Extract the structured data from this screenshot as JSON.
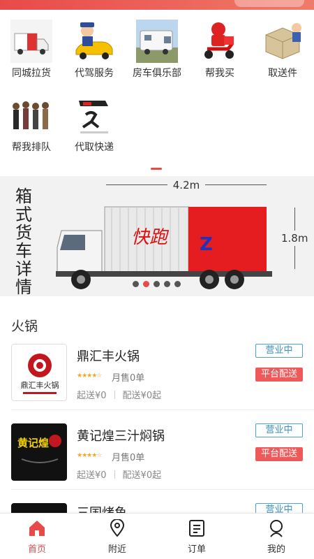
{
  "services": [
    {
      "label": "同城拉货",
      "icon": "truck-icon"
    },
    {
      "label": "代驾服务",
      "icon": "chauffeur-icon"
    },
    {
      "label": "房车俱乐部",
      "icon": "rv-icon"
    },
    {
      "label": "帮我买",
      "icon": "delivery-scooter-icon"
    },
    {
      "label": "取送件",
      "icon": "courier-box-icon"
    },
    {
      "label": "帮我排队",
      "icon": "queue-people-icon"
    },
    {
      "label": "代取快递",
      "icon": "express-run-icon"
    }
  ],
  "banner": {
    "title": "箱式货车详情",
    "width_label": "4.2m",
    "height_label": "1.8m",
    "truck_text": "快跑",
    "truck_letter": "Z",
    "slide_count": 5,
    "active_slide": 1
  },
  "section": {
    "title": "火锅"
  },
  "shops": [
    {
      "name": "鼎汇丰火锅",
      "rating": 4,
      "sales": "月售0单",
      "min_order": "起送¥0",
      "delivery_fee": "配送¥0起",
      "status": "营业中",
      "delivery_badge": "平台配送",
      "logo_text": "鼎汇丰火锅"
    },
    {
      "name": "黄记煌三汁焖锅",
      "rating": 4,
      "sales": "月售0单",
      "min_order": "起送¥0",
      "delivery_fee": "配送¥0起",
      "status": "营业中",
      "delivery_badge": "平台配送",
      "logo_text": "黄记煌"
    },
    {
      "name": "三国烤鱼",
      "status": "营业中"
    }
  ],
  "tabs": [
    {
      "label": "首页",
      "icon": "home-icon",
      "active": true
    },
    {
      "label": "附近",
      "icon": "location-pin-icon",
      "active": false
    },
    {
      "label": "订单",
      "icon": "order-list-icon",
      "active": false
    },
    {
      "label": "我的",
      "icon": "profile-icon",
      "active": false
    }
  ],
  "colors": {
    "accent": "#e84a4a",
    "open_badge": "#3c8fc0",
    "stars": "#f5a623"
  }
}
